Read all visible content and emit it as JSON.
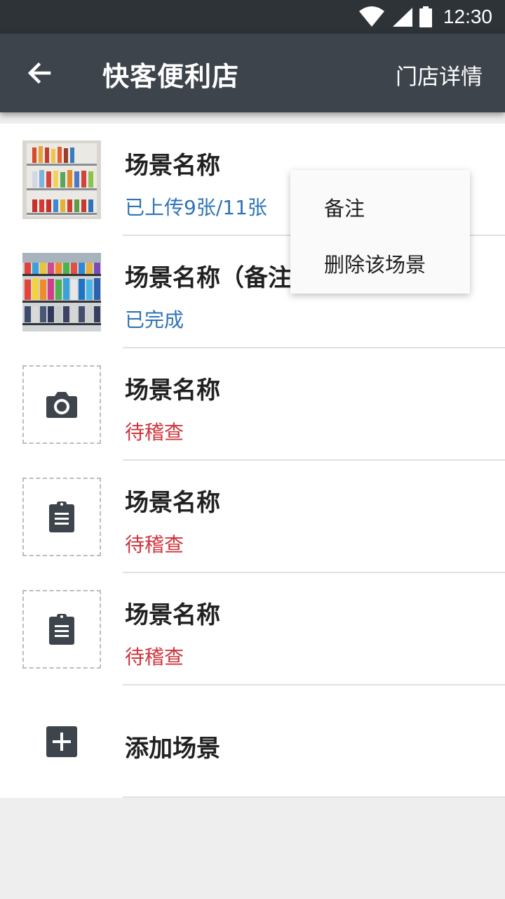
{
  "status_bar": {
    "time": "12:30",
    "icons": [
      "wifi-icon",
      "signal-icon",
      "battery-icon"
    ]
  },
  "toolbar": {
    "title": "快客便利店",
    "action_label": "门店详情",
    "back_icon": "arrow-left-icon"
  },
  "scenes": [
    {
      "name": "场景名称",
      "status": "已上传9张/11张",
      "status_color": "#2f74b5",
      "thumb": "photo"
    },
    {
      "name": "场景名称（备注",
      "status": "已完成",
      "status_color": "#2f74b5",
      "thumb": "photo"
    },
    {
      "name": "场景名称",
      "status": "待稽查",
      "status_color": "#d0343c",
      "thumb": "camera-icon"
    },
    {
      "name": "场景名称",
      "status": "待稽查",
      "status_color": "#d0343c",
      "thumb": "clipboard-icon"
    },
    {
      "name": "场景名称",
      "status": "待稽查",
      "status_color": "#d0343c",
      "thumb": "clipboard-icon"
    }
  ],
  "add_scene": {
    "label": "添加场景",
    "icon": "add-box-icon"
  },
  "popup_menu": {
    "items": [
      "备注",
      "删除该场景"
    ]
  }
}
